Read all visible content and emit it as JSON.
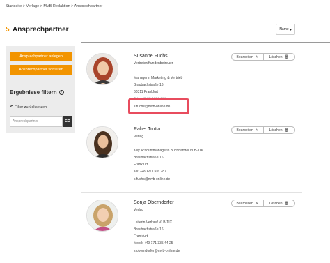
{
  "breadcrumb": "Startseite > Verlage > MVB Redaktion > Ansprechpartner",
  "header": {
    "count": "5",
    "title": "Ansprechpartner"
  },
  "sort": {
    "selected": "Name"
  },
  "sidebar": {
    "add_label": "Ansprechpartner anlegen",
    "sort_label": "Ansprechpartner sortieren",
    "filter_title": "Ergebnisse filtern",
    "reset_label": "Filter zurücksetzen",
    "search_placeholder": "Ansprechpartner",
    "go_label": "GO"
  },
  "actions": {
    "edit": "Bearbeiten",
    "delete": "Löschen"
  },
  "contacts": [
    {
      "name": "Susanne Fuchs",
      "role": "Vertreter/Kundenbetreuer",
      "lines": [
        "Managerin Marketing & Vertrieb",
        "Braubachstraße 16",
        "60311 Frankfurt",
        "Tel: +49 69 1306 287",
        "s.fuchs@mvb-online.de"
      ]
    },
    {
      "name": "Rahel Trotta",
      "role": "Verlag",
      "lines": [
        "Key Accountmanagerin Buchhandel VLB-TIX",
        "Braubachstraße 16",
        "Frankfurt",
        "Tel: +49 69 1306 287",
        "s.fuchs@mvb-online.de"
      ]
    },
    {
      "name": "Sonja Oberndorfer",
      "role": "Verlag",
      "lines": [
        "Leiterin Verkauf VLB-TIX",
        "Braubachstraße 16",
        "Frankfurt",
        "Mobil: +49 171 335 44 25",
        "s.oberndorfer@mvb-online.de"
      ]
    }
  ],
  "colors": {
    "accent": "#f29400",
    "highlight": "#e84c5e",
    "sidebar_bg": "#ececec"
  }
}
